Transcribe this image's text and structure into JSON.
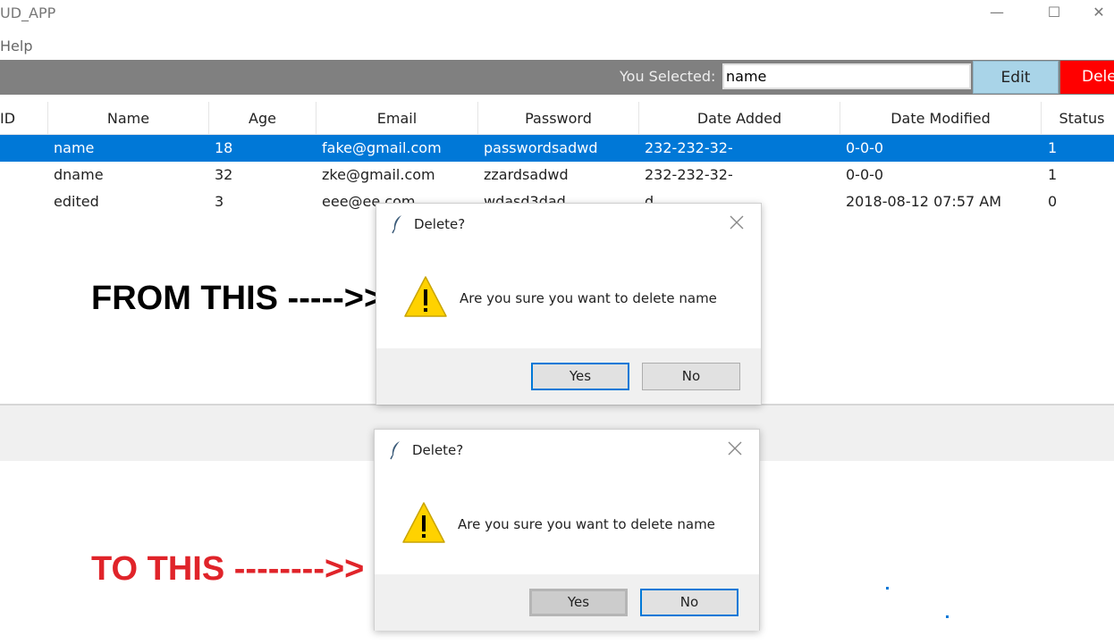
{
  "window": {
    "title": "UD_APP",
    "minimize_glyph": "—",
    "maximize_glyph": "☐",
    "close_glyph": "✕"
  },
  "menu": {
    "items": [
      "Help"
    ]
  },
  "toolbar": {
    "selected_label": "You Selected:",
    "selected_value": "name",
    "edit_label": "Edit",
    "delete_label": "Delete"
  },
  "table": {
    "columns": [
      "ID",
      "Name",
      "Age",
      "Email",
      "Password",
      "Date Added",
      "Date Modified",
      "Status"
    ],
    "rows": [
      {
        "id": "",
        "name": "name",
        "age": "18",
        "email": "fake@gmail.com",
        "password": "passwordsadwd",
        "date_added": "232-232-32-",
        "date_modified": "0-0-0",
        "status": "1"
      },
      {
        "id": "",
        "name": "dname",
        "age": "32",
        "email": "zke@gmail.com",
        "password": "zzardsadwd",
        "date_added": "232-232-32-",
        "date_modified": "0-0-0",
        "status": "1"
      },
      {
        "id": "",
        "name": "edited",
        "age": "3",
        "email": "eee@ee.com",
        "password": "wdasd3dad",
        "date_added": "d",
        "date_modified": "2018-08-12 07:57 AM",
        "status": "0"
      }
    ],
    "selected_row_index": 0
  },
  "annotations": {
    "from": "FROM THIS ----->>",
    "to": "TO THIS -------->>"
  },
  "dialogs": [
    {
      "title": "Delete?",
      "message": "Are you sure you want to delete name",
      "yes_label": "Yes",
      "no_label": "No",
      "focused": "yes"
    },
    {
      "title": "Delete?",
      "message": "Are you sure you want to delete name",
      "yes_label": "Yes",
      "no_label": "No",
      "focused": "no"
    }
  ],
  "colors": {
    "selection": "#0078d7",
    "edit_button": "#a9d4e8",
    "delete_button": "#ff0000",
    "toolbar_bg": "#808080",
    "to_annotation": "#e0242a"
  },
  "icons": {
    "dialog_app_icon": "feather-icon",
    "dialog_warning": "warning-icon",
    "dialog_close": "close-icon"
  }
}
